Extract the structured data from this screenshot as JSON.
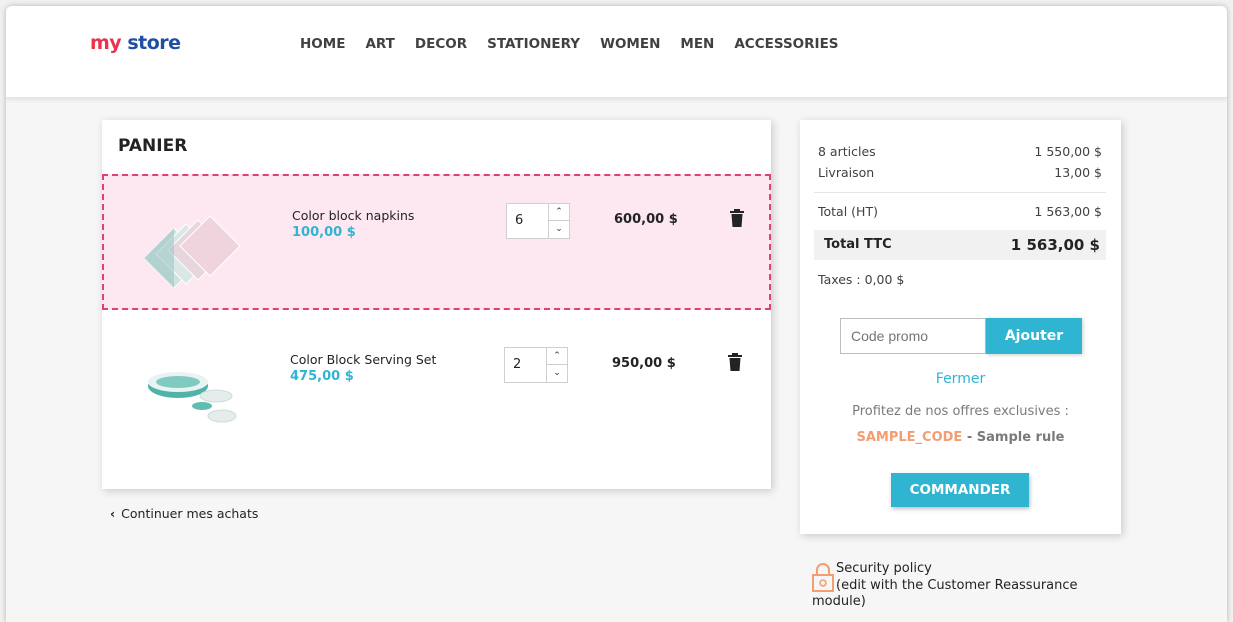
{
  "brand": {
    "logo_part1": "my",
    "logo_part2": "store"
  },
  "nav": {
    "items": [
      "HOME",
      "ART",
      "DECOR",
      "STATIONERY",
      "WOMEN",
      "MEN",
      "ACCESSORIES"
    ]
  },
  "cart": {
    "title": "PANIER",
    "lines": [
      {
        "name": "Color block napkins",
        "unit_price": "100,00 $",
        "quantity": "6",
        "total": "600,00 $"
      },
      {
        "name": "Color Block Serving Set",
        "unit_price": "475,00 $",
        "quantity": "2",
        "total": "950,00 $"
      }
    ],
    "continue_label": "Continuer mes achats"
  },
  "summary": {
    "articles_label": "8 articles",
    "articles_value": "1 550,00 $",
    "shipping_label": "Livraison",
    "shipping_value": "13,00 $",
    "total_ht_label": "Total (HT)",
    "total_ht_value": "1 563,00 $",
    "total_ttc_label": "Total TTC",
    "total_ttc_value": "1 563,00 $",
    "taxes": "Taxes : 0,00 $",
    "promo_placeholder": "Code promo",
    "promo_button": "Ajouter",
    "close_label": "Fermer",
    "offers_text": "Profitez de nos offres exclusives :",
    "offer_code": "SAMPLE_CODE",
    "offer_rule": " - Sample rule",
    "checkout_label": "COMMANDER"
  },
  "reassurance": {
    "title": "Security policy",
    "subtitle": "(edit with the Customer Reassurance",
    "subtitle_end": "module)"
  },
  "colors": {
    "accent": "#2fb5d2",
    "highlight_bg": "#fde8f1",
    "highlight_border": "#e0407a",
    "offer_code": "#f39d72"
  }
}
